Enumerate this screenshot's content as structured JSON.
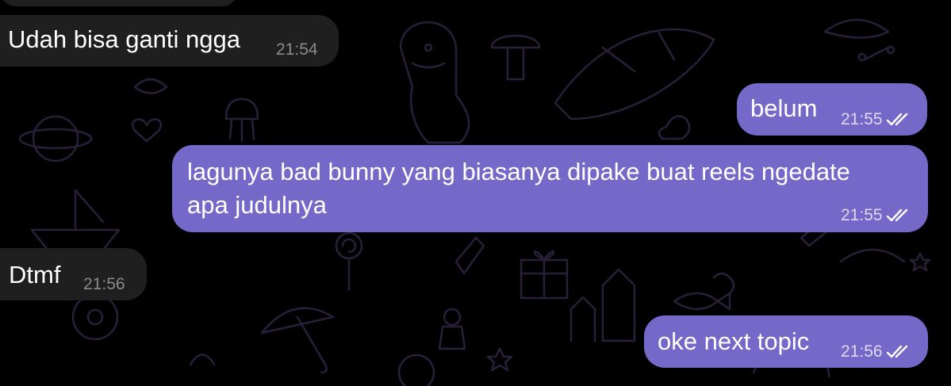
{
  "chat": {
    "messages": [
      {
        "id": "m1",
        "direction": "incoming",
        "text": "Udah bisa ganti ngga",
        "time": "21:54"
      },
      {
        "id": "m2",
        "direction": "outgoing",
        "text": "belum",
        "time": "21:55",
        "status": "read"
      },
      {
        "id": "m3",
        "direction": "outgoing",
        "line1": "lagunya bad bunny yang biasanya dipake buat reels ngedate",
        "line2": "apa judulnya",
        "time": "21:55",
        "status": "read"
      },
      {
        "id": "m4",
        "direction": "incoming",
        "text": "Dtmf",
        "time": "21:56"
      },
      {
        "id": "m5",
        "direction": "outgoing",
        "text": "oke next topic",
        "time": "21:56",
        "status": "read"
      }
    ]
  },
  "colors": {
    "background": "#000000",
    "incoming_bubble": "#1f1f1f",
    "outgoing_bubble": "#7468c8",
    "doodle_stroke": "#2a1f38"
  },
  "icons": {
    "read_receipt": "double-check-icon",
    "wallpaper": "doodle-pattern"
  }
}
